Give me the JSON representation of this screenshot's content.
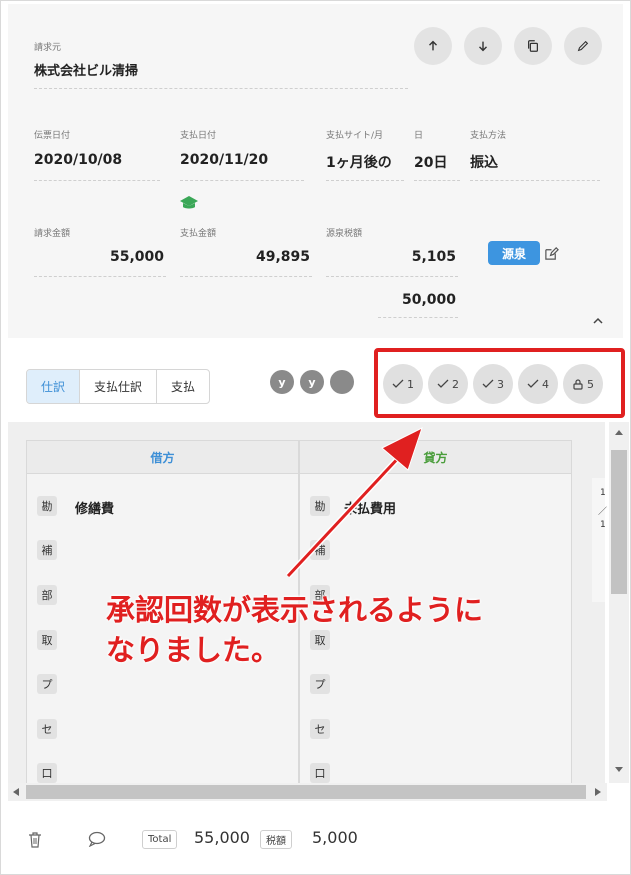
{
  "header": {
    "billing_source_label": "請求元",
    "billing_source_value": "株式会社ビル清掃"
  },
  "actions": {
    "up_icon": "arrow-up-icon",
    "down_icon": "arrow-down-icon",
    "copy_icon": "copy-icon",
    "edit_icon": "pencil-icon"
  },
  "dates": {
    "slip_date_label": "伝票日付",
    "slip_date_value": "2020/10/08",
    "payment_date_label": "支払日付",
    "payment_date_value": "2020/11/20",
    "payment_site_label": "支払サイト/月",
    "payment_site_value": "1ヶ月後の",
    "day_label": "日",
    "day_value": "20日",
    "payment_method_label": "支払方法",
    "payment_method_value": "振込"
  },
  "amounts": {
    "invoice_amount_label": "請求金額",
    "invoice_amount_value": "55,000",
    "payment_amount_label": "支払金額",
    "payment_amount_value": "49,895",
    "withholding_label": "源泉税額",
    "withholding_value": "5,105",
    "withholding_base_value": "50,000",
    "gensen_button": "源泉"
  },
  "tabs": [
    {
      "label": "仕訳",
      "active": true
    },
    {
      "label": "支払仕訳",
      "active": false
    },
    {
      "label": "支払",
      "active": false
    }
  ],
  "avatars": [
    "y",
    "y",
    ""
  ],
  "approvals": [
    {
      "icon": "check-icon",
      "count": "1"
    },
    {
      "icon": "check-icon",
      "count": "2"
    },
    {
      "icon": "check-icon",
      "count": "3"
    },
    {
      "icon": "check-icon",
      "count": "4"
    },
    {
      "icon": "lock-icon",
      "count": "5"
    }
  ],
  "journal": {
    "debit_header": "借方",
    "credit_header": "貸方",
    "debit_header_color": "#3d8fd6",
    "credit_header_color": "#4a9d3b",
    "row_tags": [
      "勘",
      "補",
      "部",
      "取",
      "プ",
      "セ",
      "口"
    ],
    "debit_account": "修繕費",
    "credit_account": "未払費用",
    "side_text": [
      "1",
      "／",
      "1"
    ]
  },
  "callout": {
    "line1": "承認回数が表示されるように",
    "line2": "なりました。",
    "color": "#e02020"
  },
  "footer": {
    "total_label": "Total",
    "total_value": "55,000",
    "tax_label": "税額",
    "tax_value": "5,000"
  }
}
